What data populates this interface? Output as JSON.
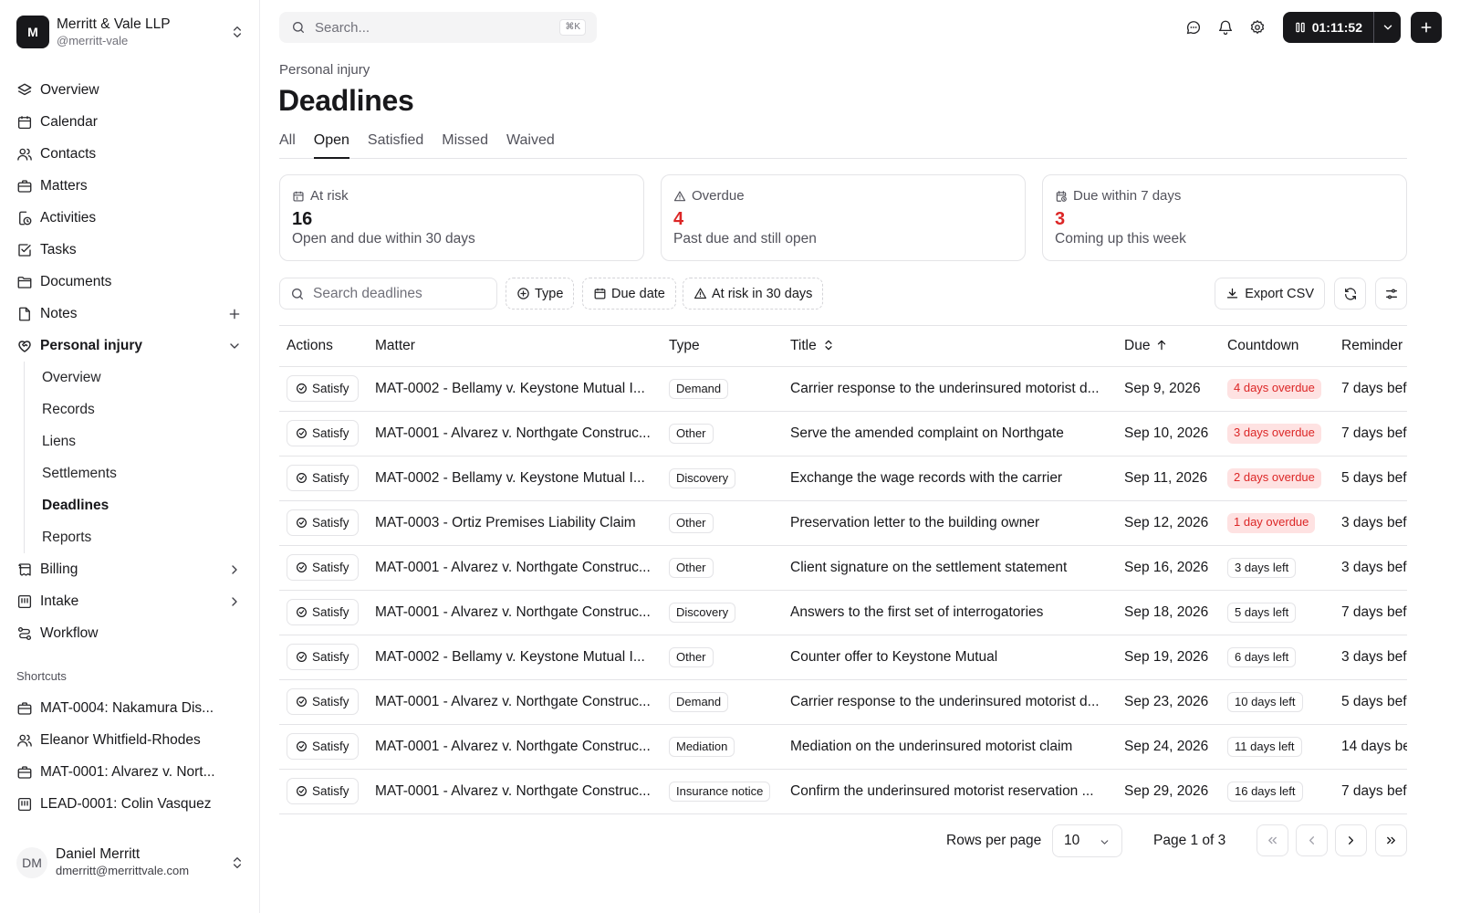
{
  "org": {
    "logo_letter": "M",
    "name": "Merritt & Vale LLP",
    "handle": "@merritt-vale"
  },
  "nav": {
    "items": [
      {
        "label": "Overview",
        "icon": "layers-icon"
      },
      {
        "label": "Calendar",
        "icon": "calendar-icon"
      },
      {
        "label": "Contacts",
        "icon": "users-icon"
      },
      {
        "label": "Matters",
        "icon": "briefcase-icon"
      },
      {
        "label": "Activities",
        "icon": "clock-activity-icon"
      },
      {
        "label": "Tasks",
        "icon": "checkbox-icon"
      },
      {
        "label": "Documents",
        "icon": "folder-icon"
      },
      {
        "label": "Notes",
        "icon": "file-icon"
      }
    ],
    "personal_injury": {
      "label": "Personal injury",
      "icon": "heart-handshake-icon"
    },
    "sub_items": [
      "Overview",
      "Records",
      "Liens",
      "Settlements",
      "Deadlines",
      "Reports"
    ],
    "billing": {
      "label": "Billing",
      "icon": "receipt-icon"
    },
    "intake": {
      "label": "Intake",
      "icon": "inbox-icon"
    },
    "workflow": {
      "label": "Workflow",
      "icon": "workflow-icon"
    }
  },
  "shortcuts": {
    "title": "Shortcuts",
    "items": [
      {
        "label": "MAT-0004: Nakamura Dis...",
        "icon": "briefcase-icon"
      },
      {
        "label": "Eleanor Whitfield-Rhodes",
        "icon": "users-icon"
      },
      {
        "label": "MAT-0001: Alvarez v. Nort...",
        "icon": "briefcase-icon"
      },
      {
        "label": "LEAD-0001: Colin Vasquez",
        "icon": "inbox-icon"
      }
    ]
  },
  "user": {
    "initials": "DM",
    "name": "Daniel Merritt",
    "email": "dmerritt@merrittvale.com"
  },
  "topbar": {
    "search_placeholder": "Search...",
    "shortcut": "⌘K",
    "timer": "01:11:52"
  },
  "page": {
    "breadcrumb": "Personal injury",
    "title": "Deadlines"
  },
  "tabs": [
    "All",
    "Open",
    "Satisfied",
    "Missed",
    "Waived"
  ],
  "active_tab": "Open",
  "cards": [
    {
      "label": "At risk",
      "value": "16",
      "sub": "Open and due within 30 days",
      "icon": "calendar-icon",
      "value_color": "#18181b"
    },
    {
      "label": "Overdue",
      "value": "4",
      "sub": "Past due and still open",
      "icon": "alert-triangle-icon",
      "value_color": "#dc2626"
    },
    {
      "label": "Due within 7 days",
      "value": "3",
      "sub": "Coming up this week",
      "icon": "calendar-clock-icon",
      "value_color": "#dc2626"
    }
  ],
  "toolbar": {
    "search_placeholder": "Search deadlines",
    "filter_type": "Type",
    "filter_due": "Due date",
    "filter_risk": "At risk in 30 days",
    "export": "Export CSV"
  },
  "table": {
    "columns": [
      "Actions",
      "Matter",
      "Type",
      "Title",
      "Due",
      "Countdown",
      "Reminder"
    ],
    "action_label": "Satisfy",
    "rows": [
      {
        "matter": "MAT-0002 - Bellamy v. Keystone Mutual I...",
        "type": "Demand",
        "title": "Carrier response to the underinsured motorist d...",
        "due": "Sep 9, 2026",
        "countdown": "4 days overdue",
        "overdue": true,
        "reminder": "7 days bef"
      },
      {
        "matter": "MAT-0001 - Alvarez v. Northgate Construc...",
        "type": "Other",
        "title": "Serve the amended complaint on Northgate",
        "due": "Sep 10, 2026",
        "countdown": "3 days overdue",
        "overdue": true,
        "reminder": "7 days bef"
      },
      {
        "matter": "MAT-0002 - Bellamy v. Keystone Mutual I...",
        "type": "Discovery",
        "title": "Exchange the wage records with the carrier",
        "due": "Sep 11, 2026",
        "countdown": "2 days overdue",
        "overdue": true,
        "reminder": "5 days bef"
      },
      {
        "matter": "MAT-0003 - Ortiz Premises Liability Claim",
        "type": "Other",
        "title": "Preservation letter to the building owner",
        "due": "Sep 12, 2026",
        "countdown": "1 day overdue",
        "overdue": true,
        "reminder": "3 days bef"
      },
      {
        "matter": "MAT-0001 - Alvarez v. Northgate Construc...",
        "type": "Other",
        "title": "Client signature on the settlement statement",
        "due": "Sep 16, 2026",
        "countdown": "3 days left",
        "overdue": false,
        "reminder": "3 days bef"
      },
      {
        "matter": "MAT-0001 - Alvarez v. Northgate Construc...",
        "type": "Discovery",
        "title": "Answers to the first set of interrogatories",
        "due": "Sep 18, 2026",
        "countdown": "5 days left",
        "overdue": false,
        "reminder": "7 days bef"
      },
      {
        "matter": "MAT-0002 - Bellamy v. Keystone Mutual I...",
        "type": "Other",
        "title": "Counter offer to Keystone Mutual",
        "due": "Sep 19, 2026",
        "countdown": "6 days left",
        "overdue": false,
        "reminder": "3 days bef"
      },
      {
        "matter": "MAT-0001 - Alvarez v. Northgate Construc...",
        "type": "Demand",
        "title": "Carrier response to the underinsured motorist d...",
        "due": "Sep 23, 2026",
        "countdown": "10 days left",
        "overdue": false,
        "reminder": "5 days bef"
      },
      {
        "matter": "MAT-0001 - Alvarez v. Northgate Construc...",
        "type": "Mediation",
        "title": "Mediation on the underinsured motorist claim",
        "due": "Sep 24, 2026",
        "countdown": "11 days left",
        "overdue": false,
        "reminder": "14 days be"
      },
      {
        "matter": "MAT-0001 - Alvarez v. Northgate Construc...",
        "type": "Insurance notice",
        "title": "Confirm the underinsured motorist reservation ...",
        "due": "Sep 29, 2026",
        "countdown": "16 days left",
        "overdue": false,
        "reminder": "7 days bef"
      }
    ]
  },
  "pagination": {
    "rows_label": "Rows per page",
    "rows_value": "10",
    "page_label": "Page 1 of 3"
  },
  "colors": {
    "accent": "#18181b",
    "danger": "#dc2626",
    "danger_bg": "#fee2e2",
    "border": "#e4e4e7"
  }
}
